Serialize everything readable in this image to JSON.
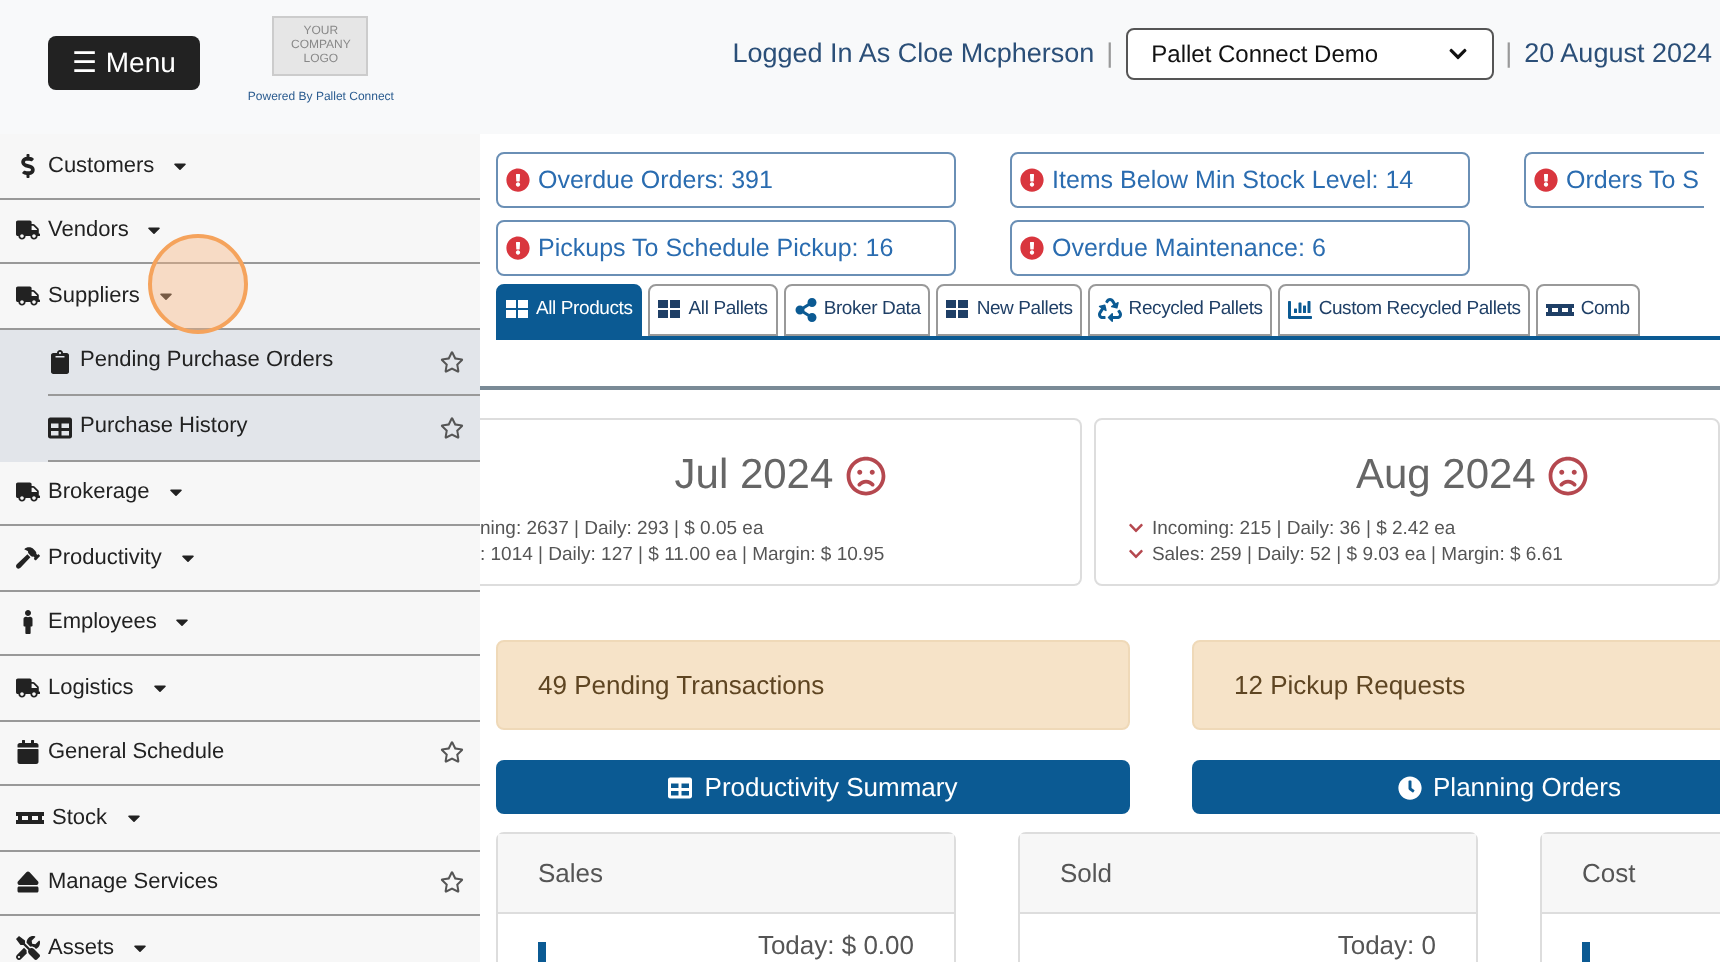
{
  "header": {
    "menu_button": "☰ Menu",
    "logo_lines": [
      "YOUR",
      "COMPANY",
      "LOGO"
    ],
    "powered_by": "Powered By Pallet Connect",
    "logged_in": "Logged In As Cloe Mcpherson",
    "separator_1": "|",
    "company_select": "Pallet Connect Demo",
    "separator_2": "|",
    "date": "20 August 2024"
  },
  "sidebar": {
    "items": [
      {
        "label": "Customers",
        "kind": "dropdown"
      },
      {
        "label": "Vendors",
        "kind": "dropdown"
      },
      {
        "label": "Suppliers",
        "kind": "dropdown",
        "children": [
          {
            "label": "Pending Purchase Orders",
            "starred": false
          },
          {
            "label": "Purchase History",
            "starred": false
          }
        ]
      },
      {
        "label": "Brokerage",
        "kind": "dropdown"
      },
      {
        "label": "Productivity",
        "kind": "dropdown"
      },
      {
        "label": "Employees",
        "kind": "dropdown"
      },
      {
        "label": "Logistics",
        "kind": "dropdown"
      },
      {
        "label": "General Schedule",
        "kind": "link",
        "starred": false
      },
      {
        "label": "Stock",
        "kind": "dropdown"
      },
      {
        "label": "Manage Services",
        "kind": "link",
        "starred": false
      },
      {
        "label": "Assets",
        "kind": "dropdown"
      }
    ]
  },
  "alerts": [
    {
      "label": "Overdue Orders: 391"
    },
    {
      "label": "Items Below Min Stock Level: 14"
    },
    {
      "label": "Orders To S"
    },
    {
      "label": "Pickups To Schedule Pickup: 16"
    },
    {
      "label": "Overdue Maintenance: 6"
    }
  ],
  "tabs": [
    {
      "label": "All Products",
      "selected": true
    },
    {
      "label": "All Pallets",
      "selected": false
    },
    {
      "label": "Broker Data",
      "selected": false
    },
    {
      "label": "New Pallets",
      "selected": false
    },
    {
      "label": "Recycled Pallets",
      "selected": false
    },
    {
      "label": "Custom Recycled Pallets",
      "selected": false
    },
    {
      "label": "Comb",
      "selected": false
    }
  ],
  "months": [
    {
      "title": "Jul 2024",
      "lines": [
        {
          "text": "ning: 2637 | Daily: 293 | $ 0.05 ea",
          "kind": "plain"
        },
        {
          "text": ": 1014 | Daily: 127 | $ 11.00 ea | Margin: $ 10.95",
          "kind": "plain"
        }
      ]
    },
    {
      "title": "Aug 2024",
      "lines": [
        {
          "text": "Incoming: 215 | Daily: 36 | $ 2.42 ea",
          "kind": "down"
        },
        {
          "text": "Sales: 259 | Daily: 52 | $ 9.03 ea | Margin: $ 6.61",
          "kind": "down"
        }
      ]
    }
  ],
  "notices": [
    "49 Pending Transactions",
    "12 Pickup Requests"
  ],
  "action_buttons": [
    "Productivity Summary",
    "Planning Orders"
  ],
  "summary_cards": [
    {
      "title": "Sales",
      "today": "Today: $ 0.00",
      "kind": "chart"
    },
    {
      "title": "Sold",
      "today": "Today: 0",
      "kind": "plain"
    },
    {
      "title": "Cost",
      "kind": "chart"
    }
  ]
}
